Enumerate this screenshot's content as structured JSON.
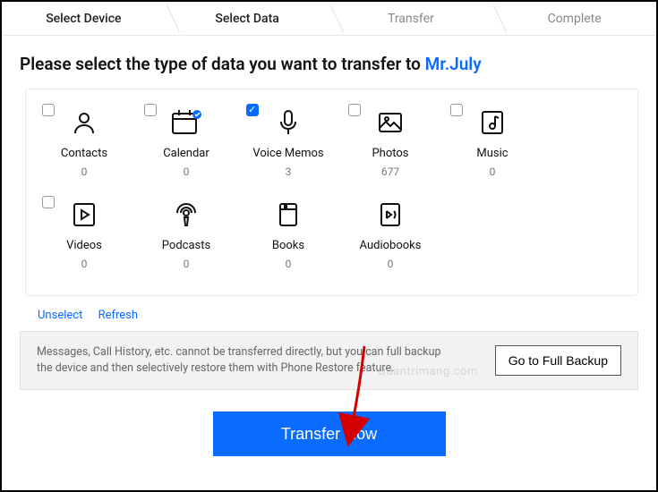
{
  "stepper": {
    "steps": [
      {
        "label": "Select Device",
        "state": "done"
      },
      {
        "label": "Select Data",
        "state": "done"
      },
      {
        "label": "Transfer",
        "state": "todo"
      },
      {
        "label": "Complete",
        "state": "todo"
      }
    ]
  },
  "heading": {
    "prefix": "Please select the type of data you want to transfer to ",
    "target": "Mr.July"
  },
  "dataTypes": [
    {
      "key": "contacts",
      "label": "Contacts",
      "count": "0",
      "checked": false,
      "icon": "contact"
    },
    {
      "key": "calendar",
      "label": "Calendar",
      "count": "0",
      "checked": false,
      "icon": "calendar"
    },
    {
      "key": "voicememos",
      "label": "Voice Memos",
      "count": "3",
      "checked": true,
      "icon": "mic"
    },
    {
      "key": "photos",
      "label": "Photos",
      "count": "677",
      "checked": false,
      "icon": "image"
    },
    {
      "key": "music",
      "label": "Music",
      "count": "0",
      "checked": false,
      "icon": "music"
    },
    {
      "key": "videos",
      "label": "Videos",
      "count": "0",
      "checked": false,
      "icon": "video"
    },
    {
      "key": "podcasts",
      "label": "Podcasts",
      "count": "0",
      "checked": false,
      "icon": "podcast"
    },
    {
      "key": "books",
      "label": "Books",
      "count": "0",
      "checked": false,
      "icon": "book"
    },
    {
      "key": "audiobooks",
      "label": "Audiobooks",
      "count": "0",
      "checked": false,
      "icon": "audiobook"
    }
  ],
  "links": {
    "unselect": "Unselect",
    "refresh": "Refresh"
  },
  "note": {
    "text": "Messages, Call History, etc. cannot be transferred directly, but you can full backup the device and then selectively restore them with Phone Restore feature.",
    "button": "Go to Full Backup"
  },
  "transfer": "Transfer Now",
  "watermark": "Quantrimang.com",
  "colors": {
    "accent": "#0a6bff"
  }
}
